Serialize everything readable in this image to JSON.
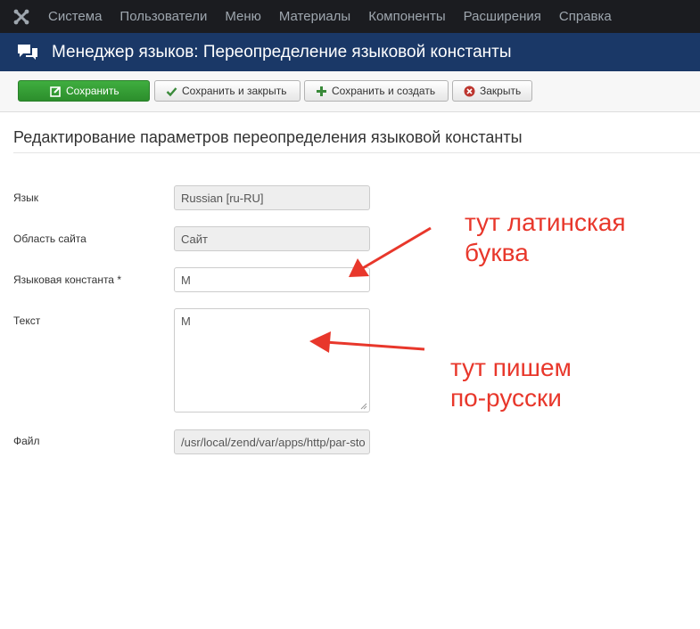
{
  "topnav": {
    "logo_icon": "joomla-logo-icon",
    "items": [
      "Система",
      "Пользователи",
      "Меню",
      "Материалы",
      "Компоненты",
      "Расширения",
      "Справка"
    ]
  },
  "titlebar": {
    "icon": "comments-icon",
    "title": "Менеджер языков: Переопределение языковой константы"
  },
  "toolbar": {
    "save": {
      "label": "Сохранить",
      "icon": "edit-icon"
    },
    "save_close": {
      "label": "Сохранить и закрыть",
      "icon": "check-icon"
    },
    "save_new": {
      "label": "Сохранить и создать",
      "icon": "plus-icon"
    },
    "close": {
      "label": "Закрыть",
      "icon": "cancel-circle-icon"
    }
  },
  "form": {
    "legend": "Редактирование параметров переопределения языковой константы",
    "language": {
      "label": "Язык",
      "value": "Russian [ru-RU]"
    },
    "client": {
      "label": "Область сайта",
      "value": "Сайт"
    },
    "key": {
      "label": "Языковая константа *",
      "value": "М"
    },
    "text": {
      "label": "Текст",
      "value": "М"
    },
    "file": {
      "label": "Файл",
      "value": "/usr/local/zend/var/apps/http/par-sto"
    }
  },
  "annotations": {
    "top": [
      "тут латинская",
      "буква"
    ],
    "bottom": [
      "тут пишем",
      "по-русски"
    ],
    "color": "#e8372b"
  },
  "colors": {
    "topnav_bg": "#1b1c20",
    "titlebar_bg": "#1a3867",
    "save_button": "#3a9f3a"
  }
}
